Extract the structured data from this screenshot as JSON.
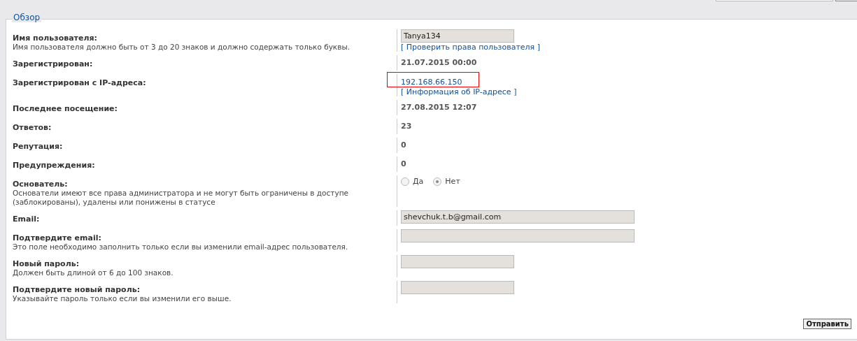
{
  "panel": {
    "title": "Обзор"
  },
  "rows": [
    {
      "kind": "input",
      "label": "Имя пользователя:",
      "explain": "Имя пользователя должно быть от 3 до 20 знаков и должно содержать только буквы.",
      "value": "Tanya134",
      "wide": false,
      "link": "[ Проверить права пользователя ]"
    },
    {
      "kind": "text",
      "label": "Зарегистрирован:",
      "value": "21.07.2015 00:00"
    },
    {
      "kind": "ip",
      "label": "Зарегистрирован с IP-адреса:",
      "value": "192.168.66.150",
      "highlighted": true,
      "link": "[ Информация об IP-адресе ]"
    },
    {
      "kind": "text",
      "label": "Последнее посещение:",
      "value": "27.08.2015 12:07"
    },
    {
      "kind": "text",
      "label": "Ответов:",
      "value": "23"
    },
    {
      "kind": "text",
      "label": "Репутация:",
      "value": "0"
    },
    {
      "kind": "text",
      "label": "Предупреждения:",
      "value": "0"
    },
    {
      "kind": "radio",
      "label": "Основатель:",
      "explain": "Основатели имеют все права администратора и не могут быть ограничены в доступе (заблокированы), удалены или понижены в статусе",
      "options": [
        {
          "label": "Да",
          "selected": false
        },
        {
          "label": "Нет",
          "selected": true
        }
      ]
    },
    {
      "kind": "input",
      "label": "Email:",
      "value": "shevchuk.t.b@gmail.com",
      "wide": true
    },
    {
      "kind": "input",
      "label": "Подтвердите email:",
      "explain": "Это поле необходимо заполнить только если вы изменили email-адрес пользователя.",
      "wide": true
    },
    {
      "kind": "input",
      "label": "Новый пароль:",
      "explain": "Должен быть длиной от 6 до 100 знаков.",
      "wide": false
    },
    {
      "kind": "input",
      "label": "Подтвердите новый пароль:",
      "explain": "Указывайте пароль только если вы изменили его выше.",
      "wide": false
    }
  ],
  "submit": "Отправить"
}
